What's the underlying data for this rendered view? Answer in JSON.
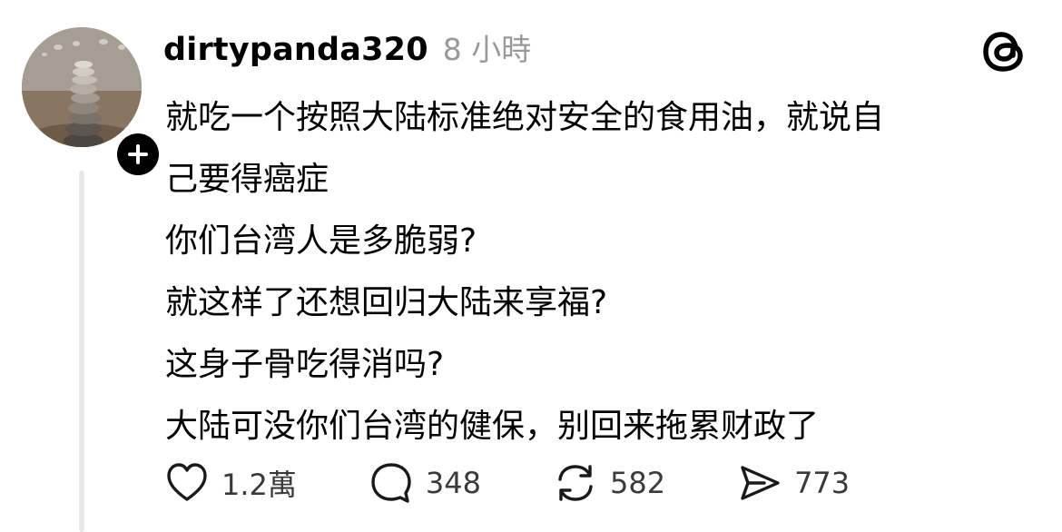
{
  "post": {
    "username": "dirtypanda320",
    "timestamp": "8 小時",
    "content_lines": [
      "就吃一个按照大陆标准绝对安全的食用油，就说自",
      "己要得癌症",
      "你们台湾人是多脆弱?",
      "就这样了还想回归大陆来享福?",
      "这身子骨吃得消吗?",
      "大陆可没你们台湾的健保，别回来拖累财政了"
    ],
    "actions": {
      "likes": "1.2萬",
      "replies": "348",
      "reposts": "582",
      "shares": "773"
    }
  },
  "icons": {
    "avatar_badge": "plus-icon",
    "app_logo": "threads-logo-icon",
    "like": "heart-icon",
    "reply": "speech-bubble-icon",
    "repost": "repost-icon",
    "share": "send-icon"
  },
  "colors": {
    "text": "#000000",
    "muted": "#999999",
    "thread_line": "#e7e7e7",
    "count_text": "#3a3a3a"
  }
}
